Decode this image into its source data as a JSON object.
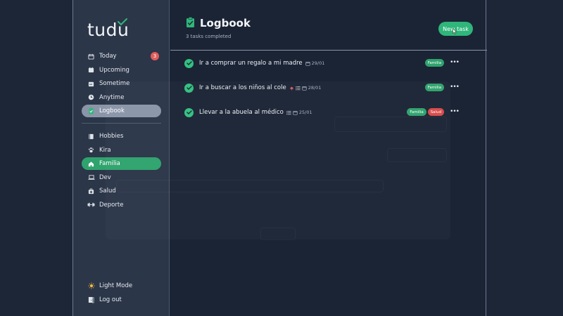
{
  "brand": {
    "logo_text": "tudu"
  },
  "sidebar": {
    "items": [
      {
        "label": "Today",
        "icon": "calendar-icon",
        "badge": "3"
      },
      {
        "label": "Upcoming",
        "icon": "calendar-fill-icon"
      },
      {
        "label": "Sometime",
        "icon": "calendar-grid-icon"
      },
      {
        "label": "Anytime",
        "icon": "clock-icon"
      },
      {
        "label": "Logbook",
        "icon": "clipboard-check-icon",
        "active": true
      }
    ],
    "projects": [
      {
        "label": "Hobbies",
        "icon": "book-icon"
      },
      {
        "label": "Kira",
        "icon": "paw-icon"
      },
      {
        "label": "Familia",
        "icon": "home-icon",
        "highlight": true
      },
      {
        "label": "Dev",
        "icon": "laptop-icon"
      },
      {
        "label": "Salud",
        "icon": "medkit-icon"
      },
      {
        "label": "Deporte",
        "icon": "dumbbell-icon"
      }
    ],
    "bottom": [
      {
        "label": "Light Mode",
        "icon": "sun-icon"
      },
      {
        "label": "Log out",
        "icon": "door-icon"
      }
    ]
  },
  "header": {
    "title": "Logbook",
    "subtitle": "3 tasks completed",
    "new_task_label": "New task"
  },
  "tasks": [
    {
      "text": "Ir a comprar un regalo a mi madre",
      "date": "29/01",
      "tags": [
        "Familia"
      ]
    },
    {
      "text": "Ir a buscar a los niños al cole",
      "date": "28/01",
      "tags": [
        "Familia"
      ],
      "has_bell": true,
      "has_list": true
    },
    {
      "text": "Llevar a la abuela al médico",
      "date": "25/01",
      "tags": [
        "Familia",
        "Salud"
      ],
      "has_list": true
    }
  ],
  "colors": {
    "accent": "#2fb67a",
    "danger": "#e05c5c",
    "sidebar_bg": "#2b3648",
    "main_bg": "#1b2435"
  }
}
